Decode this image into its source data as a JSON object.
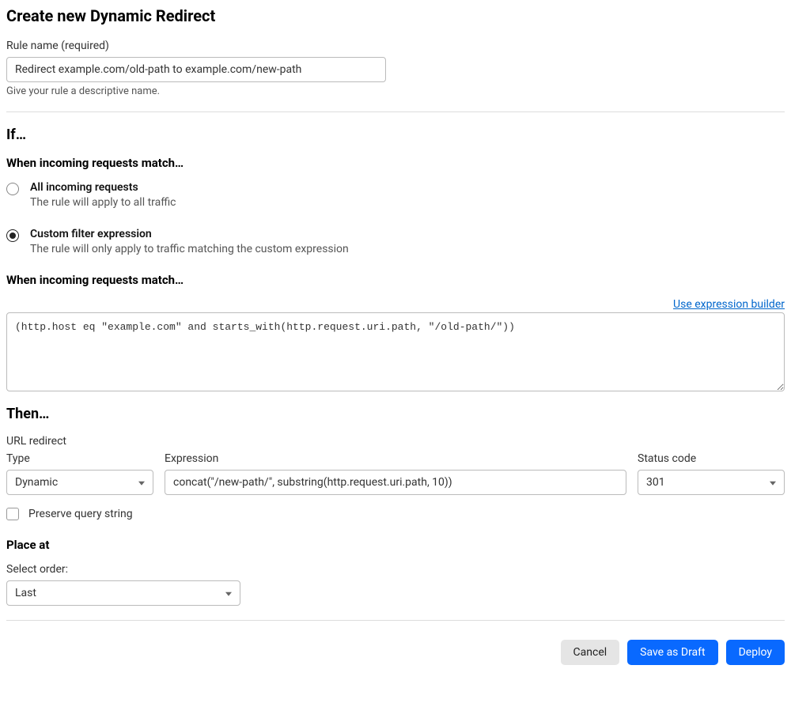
{
  "title": "Create new Dynamic Redirect",
  "ruleName": {
    "label": "Rule name (required)",
    "value": "Redirect example.com/old-path to example.com/new-path",
    "hint": "Give your rule a descriptive name."
  },
  "ifSection": {
    "heading": "If…",
    "subheading": "When incoming requests match…",
    "radios": [
      {
        "title": "All incoming requests",
        "desc": "The rule will apply to all traffic"
      },
      {
        "title": "Custom filter expression",
        "desc": "The rule will only apply to traffic matching the custom expression"
      }
    ],
    "matchHeading": "When incoming requests match…",
    "builderLink": "Use expression builder",
    "expression": "(http.host eq \"example.com\" and starts_with(http.request.uri.path, \"/old-path/\"))"
  },
  "thenSection": {
    "heading": "Then…",
    "subheading": "URL redirect",
    "typeLabel": "Type",
    "typeValue": "Dynamic",
    "expressionLabel": "Expression",
    "expressionValue": "concat(\"/new-path/\", substring(http.request.uri.path, 10))",
    "statusLabel": "Status code",
    "statusValue": "301",
    "preserveLabel": "Preserve query string"
  },
  "placeSection": {
    "heading": "Place at",
    "orderLabel": "Select order:",
    "orderValue": "Last"
  },
  "buttons": {
    "cancel": "Cancel",
    "draft": "Save as Draft",
    "deploy": "Deploy"
  }
}
